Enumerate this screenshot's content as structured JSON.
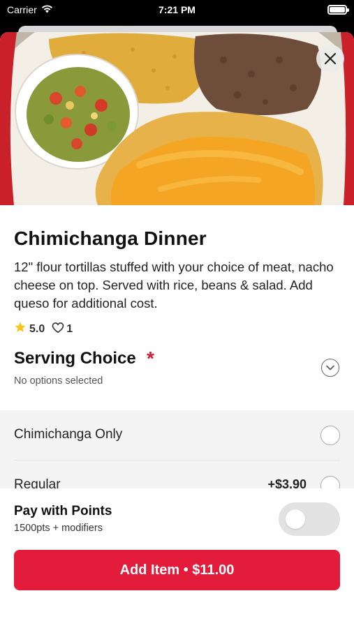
{
  "status_bar": {
    "carrier": "Carrier",
    "time": "7:21 PM",
    "battery_level": 1.0
  },
  "item": {
    "title": "Chimichanga Dinner",
    "description": "12\" flour tortillas stuffed with your choice of meat, nacho cheese on top. Served with rice, beans & salad. Add queso for additional cost.",
    "rating": "5.0",
    "likes": "1"
  },
  "serving_choice": {
    "title": "Serving Choice",
    "required_mark": "*",
    "subtitle": "No options selected",
    "options": [
      {
        "label": "Chimichanga Only",
        "price": ""
      },
      {
        "label": "Regular",
        "price": "+$3.90"
      }
    ]
  },
  "footer": {
    "points_title": "Pay with Points",
    "points_subtitle": "1500pts + modifiers",
    "toggle_on": false,
    "add_button_label": "Add Item • $11.00"
  },
  "colors": {
    "accent": "#e41c3c",
    "required": "#d21f3c",
    "star": "#f5c518"
  },
  "icons": [
    "wifi-icon",
    "battery-icon",
    "close-icon",
    "star-icon",
    "heart-icon",
    "chevron-down-icon"
  ]
}
